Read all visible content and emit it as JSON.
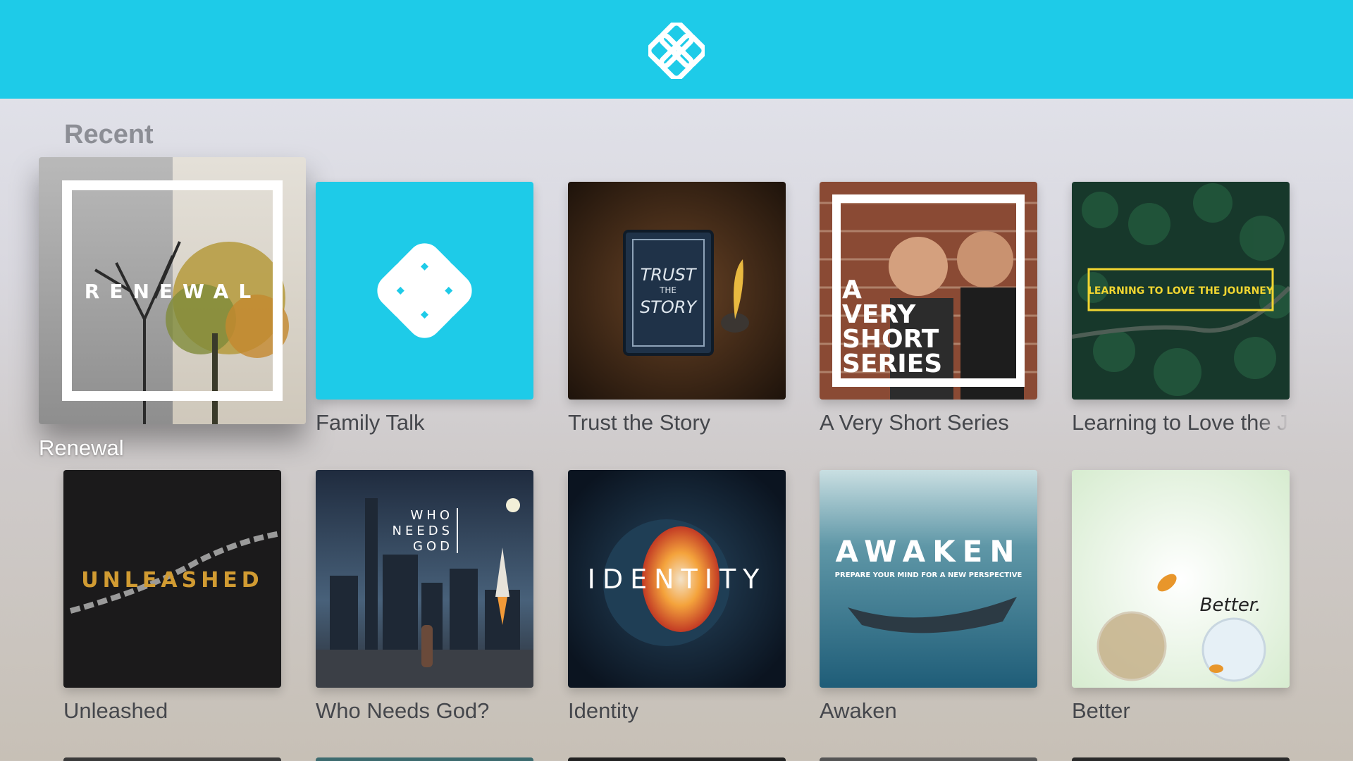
{
  "header": {
    "logo_icon": "x-knot-logo-icon",
    "accent_color": "#1ecbe8"
  },
  "section": {
    "title": "Recent"
  },
  "rows": [
    [
      {
        "title": "Renewal",
        "art_text": "RENEWAL",
        "focused": true
      },
      {
        "title": "Family Talk",
        "art_text": ""
      },
      {
        "title": "Trust the Story",
        "art_text_1": "TRUST",
        "art_text_2": "THE",
        "art_text_3": "STORY"
      },
      {
        "title": "A Very Short Series",
        "art_text_1": "A",
        "art_text_2": "VERY",
        "art_text_3": "SHORT",
        "art_text_4": "SERIES"
      },
      {
        "title": "Learning to Love the J",
        "art_text": "LEARNING TO LOVE THE JOURNEY"
      }
    ],
    [
      {
        "title": "Unleashed",
        "art_text": "UNLEASHED"
      },
      {
        "title": "Who Needs God?",
        "art_text_1": "WHO",
        "art_text_2": "NEEDS",
        "art_text_3": "GOD"
      },
      {
        "title": "Identity",
        "art_text": "IDENTITY"
      },
      {
        "title": "Awaken",
        "art_text": "AWAKEN",
        "art_sub": "PREPARE YOUR MIND FOR A NEW PERSPECTIVE"
      },
      {
        "title": "Better",
        "art_text": "Better."
      }
    ]
  ]
}
